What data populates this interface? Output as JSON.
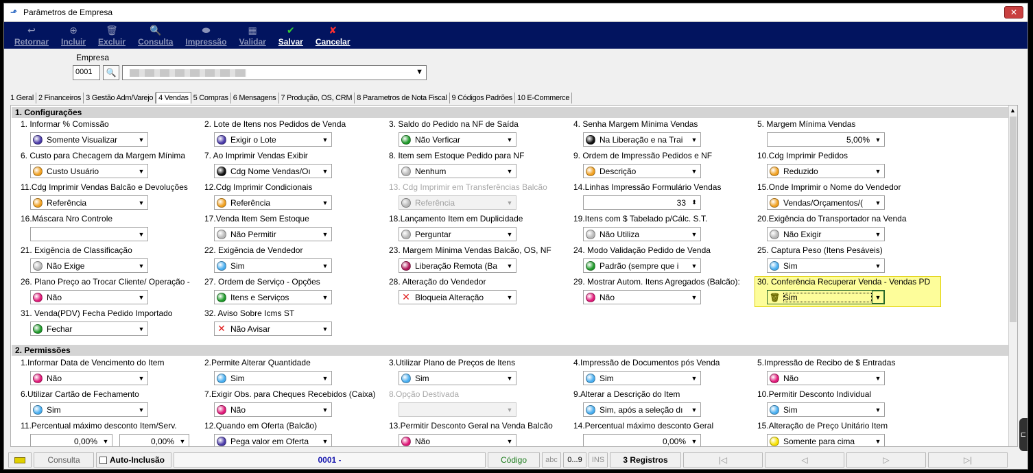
{
  "window": {
    "title": "Parâmetros de Empresa",
    "close_label": "✕"
  },
  "toolbar": [
    {
      "label": "Retornar",
      "icon": "↩",
      "icon_name": "return-icon",
      "enabled": false
    },
    {
      "label": "Incluir",
      "icon": "⊕",
      "icon_name": "add-icon",
      "enabled": false
    },
    {
      "label": "Excluir",
      "icon": "🗑",
      "icon_name": "trash-icon",
      "enabled": false
    },
    {
      "label": "Consulta",
      "icon": "🔍",
      "icon_name": "search-icon",
      "enabled": false
    },
    {
      "label": "Impressão",
      "icon": "⬬",
      "icon_name": "print-icon",
      "enabled": false
    },
    {
      "label": "Validar",
      "icon": "▦",
      "icon_name": "validate-icon",
      "enabled": false
    },
    {
      "label": "Salvar",
      "icon": "✔",
      "icon_name": "check-icon",
      "enabled": true,
      "color": "#33cc33"
    },
    {
      "label": "Cancelar",
      "icon": "✘",
      "icon_name": "cancel-icon",
      "enabled": true,
      "color": "#ff3030"
    }
  ],
  "empresa": {
    "label": "Empresa",
    "code": "0001"
  },
  "tabs": [
    "1 Geral",
    "2 Financeiros",
    "3 Gestão Adm/Varejo",
    "4 Vendas",
    "5 Compras",
    "6 Mensagens",
    "7 Produção, OS, CRM",
    "8 Parametros de Nota Fiscal",
    "9 Códigos Padrões",
    "10 E-Commerce"
  ],
  "active_tab": 3,
  "colors": {
    "purple": "#4a3aa8",
    "green": "#1f9a2a",
    "black": "#111111",
    "orange": "#f0a020",
    "gray": "#b8b8b8",
    "lightblue": "#48aef0",
    "magenta": "#e01878",
    "darkmagenta": "#b01858",
    "yellow": "#f6e000"
  },
  "sections": {
    "configuracoes": "1. Configurações",
    "permissoes": "2. Permissões"
  },
  "config_fields": [
    {
      "label": "1. Informar % Comissão",
      "value": "Somente Visualizar",
      "dot": "purple"
    },
    {
      "label": "2. Lote de Itens nos Pedidos de Venda",
      "value": "Exigir o Lote",
      "dot": "purple"
    },
    {
      "label": "3. Saldo do Pedido na NF de Saída",
      "value": "Não Verficar",
      "dot": "green"
    },
    {
      "label": "4. Senha Margem Mínima Vendas",
      "value": "Na Liberação e na Trai",
      "dot": "black"
    },
    {
      "label": "5. Margem Mínima Vendas",
      "value": "5,00%",
      "type": "num"
    },
    {
      "label": "6. Custo para Checagem da Margem Mínima",
      "value": "Custo Usuário",
      "dot": "orange"
    },
    {
      "label": "7. Ao Imprimir Vendas Exibir",
      "value": "Cdg Nome Vendas/Oı",
      "dot": "black"
    },
    {
      "label": "8. Item sem Estoque Pedido para NF",
      "value": "Nenhum",
      "dot": "gray"
    },
    {
      "label": "9. Ordem de Impressão Pedidos e NF",
      "value": "Descrição",
      "dot": "orange"
    },
    {
      "label": "10.Cdg Imprimir Pedidos",
      "value": "Reduzido",
      "dot": "orange"
    },
    {
      "label": "11.Cdg Imprimir Vendas Balcão e Devoluções",
      "value": "Referência",
      "dot": "orange"
    },
    {
      "label": "12.Cdg Imprimir Condicionais",
      "value": "Referência",
      "dot": "orange"
    },
    {
      "label": "13. Cdg Imprimir em Transferências Balcão",
      "value": "Referência",
      "dot": "gray",
      "disabled": true
    },
    {
      "label": "14.Linhas Impressão Formulário Vendas",
      "value": "33",
      "type": "spin"
    },
    {
      "label": "15.Onde Imprimir o Nome do Vendedor",
      "value": "Vendas/Orçamentos/(",
      "dot": "orange"
    },
    {
      "label": "16.Máscara Nro Controle",
      "value": "",
      "dot": ""
    },
    {
      "label": "17.Venda Item Sem Estoque",
      "value": "Não Permitir",
      "dot": "gray"
    },
    {
      "label": "18.Lançamento Item em Duplicidade",
      "value": "Perguntar",
      "dot": "gray"
    },
    {
      "label": "19.Itens com $ Tabelado p/Cálc. S.T.",
      "value": "Não Utiliza",
      "dot": "gray"
    },
    {
      "label": "20.Exigência do Transportador na Venda",
      "value": "Não Exigir",
      "dot": "gray"
    },
    {
      "label": "21. Exigência de Classificação",
      "value": "Não Exige",
      "dot": "gray"
    },
    {
      "label": "22. Exigência de Vendedor",
      "value": "Sim",
      "dot": "lightblue"
    },
    {
      "label": "23. Margem Mínima Vendas Balcão, OS, NF",
      "value": "Liberação Remota (Ba",
      "dot": "darkmagenta"
    },
    {
      "label": "24. Modo Validação Pedido de Venda",
      "value": "Padrão (sempre que i",
      "dot": "green"
    },
    {
      "label": "25. Captura Peso (Itens Pesáveis)",
      "value": "Sim",
      "dot": "lightblue"
    },
    {
      "label": "26. Plano Preço ao Trocar Cliente/ Operação -",
      "value": "Não",
      "dot": "magenta"
    },
    {
      "label": "27. Ordem de Serviço - Opções",
      "value": "Itens e Serviços",
      "dot": "green"
    },
    {
      "label": "28. Alteração do Vendedor",
      "value": "Bloqueia Alteração",
      "dot": "x"
    },
    {
      "label": "29. Mostrar Autom. Itens Agregados (Balcão):",
      "value": "Não",
      "dot": "magenta"
    },
    {
      "label": "30. Conferência Recuperar Venda - Vendas PD",
      "value": "Sim",
      "dot": "basket",
      "highlight": true
    },
    {
      "label": "31. Venda(PDV) Fecha Pedido Importado",
      "value": "Fechar",
      "dot": "green"
    },
    {
      "label": "32. Aviso Sobre Icms ST",
      "value": "Não Avisar",
      "dot": "x"
    }
  ],
  "perm_fields": [
    {
      "label": "1.Informar Data de Vencimento do Item",
      "value": "Não",
      "dot": "magenta"
    },
    {
      "label": "2.Permite Alterar Quantidade",
      "value": "Sim",
      "dot": "lightblue"
    },
    {
      "label": "3.Utilizar Plano de Preços de Itens",
      "value": "Sim",
      "dot": "lightblue"
    },
    {
      "label": "4.Impressão de Documentos pós Venda",
      "value": "Sim",
      "dot": "lightblue"
    },
    {
      "label": "5.Impressão de Recibo de $ Entradas",
      "value": "Não",
      "dot": "magenta"
    },
    {
      "label": "6.Utilizar Cartão de Fechamento",
      "value": "Sim",
      "dot": "lightblue"
    },
    {
      "label": "7.Exigir Obs. para Cheques Recebidos (Caixa)",
      "value": "Não",
      "dot": "magenta"
    },
    {
      "label": "8.Opção Destivada",
      "value": "",
      "dot": "",
      "disabled": true
    },
    {
      "label": "9.Alterar a Descrição do Item",
      "value": "Sim, após a seleção dı",
      "dot": "lightblue"
    },
    {
      "label": "10.Permitir Desconto Individual",
      "value": "Sim",
      "dot": "lightblue"
    },
    {
      "label": "11.Percentual máximo desconto Item/Serv.",
      "value": "0,00%",
      "value2": "0,00%",
      "type": "num2"
    },
    {
      "label": "12.Quando em Oferta (Balcão)",
      "value": "Pega valor em Oferta",
      "dot": "purple"
    },
    {
      "label": "13.Permitir Desconto Geral na Venda Balcão",
      "value": "Não",
      "dot": "magenta"
    },
    {
      "label": "14.Percentual máximo desconto Geral",
      "value": "0,00%",
      "type": "num"
    },
    {
      "label": "15.Alteração de Preço Unitário Item",
      "value": "Somente para cima",
      "dot": "yellow"
    }
  ],
  "statusbar": {
    "consulta": "Consulta",
    "auto_inclusao": "Auto-Inclusão",
    "record": "0001 -",
    "codigo": "Código",
    "abc": "abc",
    "range": "0...9",
    "ins": "INS",
    "registros": "3 Registros",
    "nav_first": "|◁",
    "nav_prev": "◁",
    "nav_next": "▷",
    "nav_last": "▷|"
  }
}
